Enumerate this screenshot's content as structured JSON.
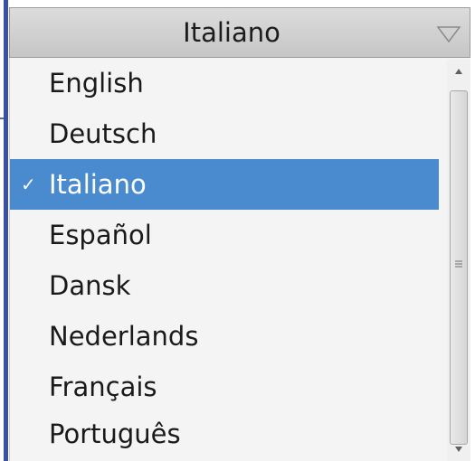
{
  "dropdown": {
    "selected_value": "Italiano",
    "arrow_icon": "chevron-down-icon"
  },
  "language_list": {
    "items": [
      {
        "label": "English",
        "selected": false
      },
      {
        "label": "Deutsch",
        "selected": false
      },
      {
        "label": "Italiano",
        "selected": true,
        "check": "✓"
      },
      {
        "label": "Español",
        "selected": false
      },
      {
        "label": "Dansk",
        "selected": false
      },
      {
        "label": "Nederlands",
        "selected": false
      },
      {
        "label": "Français",
        "selected": false
      },
      {
        "label": "Português",
        "selected": false
      }
    ]
  },
  "colors": {
    "selection": "#4a8bd0",
    "accent_edge": "#3a4fa8"
  }
}
